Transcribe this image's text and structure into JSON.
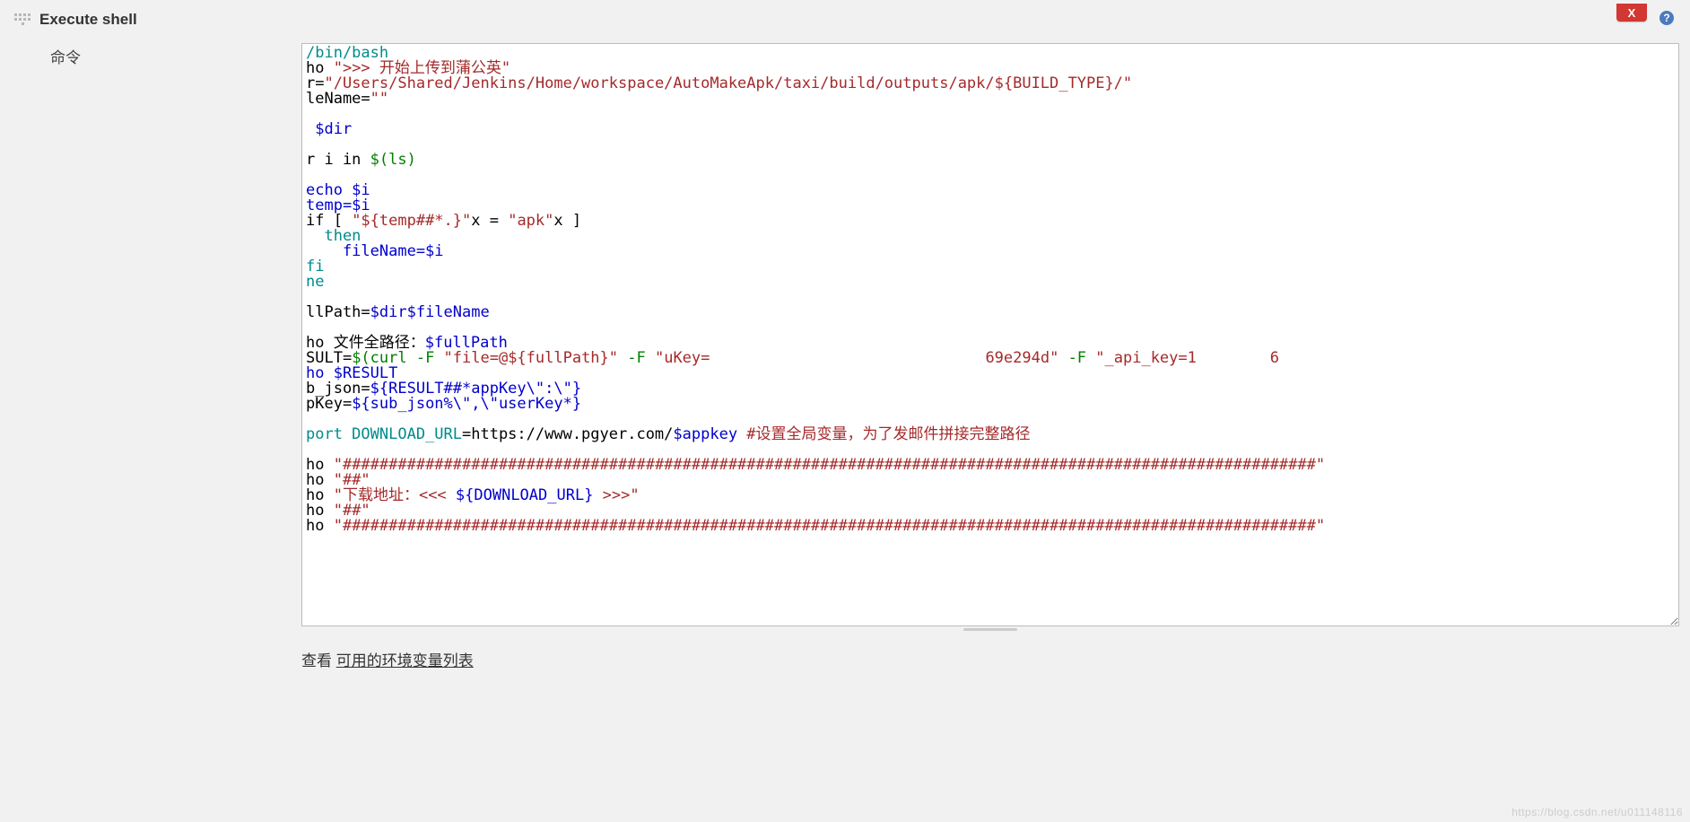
{
  "step": {
    "title": "Execute shell",
    "delete_label": "X",
    "help_label": "?",
    "command_label": "命令"
  },
  "code": {
    "shebang": "/bin/bash",
    "echo1_pre": "ho ",
    "echo1_str": "\">>> 开始上传到蒲公英\"",
    "dir_pre": "r=",
    "dir_str": "\"/Users/Shared/Jenkins/Home/workspace/AutoMakeApk/taxi/build/outputs/apk/${BUILD_TYPE}/\"",
    "filename_pre": "leName=",
    "filename_str": "\"\"",
    "cd_dir": " $dir",
    "for_pre": "r i in ",
    "for_sub": "$(ls)",
    "loop_echo": "echo $i",
    "loop_temp": "temp=$i",
    "if_pre": "if [ ",
    "if_str": "\"${temp##*.}\"",
    "if_mid": "x = ",
    "if_apk": "\"apk\"",
    "if_end": "x ]",
    "then": "  then",
    "assign_fn": "    fileName=$i",
    "fi": "fi",
    "done": "ne",
    "llpath_pre": "llPath=",
    "llpath_val": "$dir$fileName",
    "echo_full_pre": "ho 文件全路径：",
    "echo_full_val": "$fullPath",
    "result_pre": "SULT=",
    "result_sub1": "$(curl -F ",
    "result_file": "\"file=@${fullPath}\"",
    "result_flag1": " -F ",
    "result_ukey": "\"uKey=",
    "result_ukey_end": "69e294d\"",
    "result_flag2": " -F ",
    "result_api": "\"_api_key=1",
    "result_tail": "6",
    "echo_result": "ho $RESULT",
    "bjson_pre": "b_json=",
    "bjson_val": "${RESULT##*appKey\\\":\\\"}",
    "pkey_pre": "pKey=",
    "pkey_val": "${sub_json%\\\",\\\"userKey*}",
    "export_pre": "port DOWNLOAD_URL",
    "export_eq": "=https://www.pgyer.com/",
    "export_var": "$appkey",
    "export_cmt": " #设置全局变量，为了发邮件拼接完整路径",
    "hash_long": "\"##########################################################################################################\"",
    "hash_short": "\"##\"",
    "dl_pre": "ho ",
    "dl_str1": "\"下载地址：<<< ",
    "dl_var": "${DOWNLOAD_URL}",
    "dl_str2": " >>>\"",
    "ho_pre": "ho "
  },
  "footer": {
    "prefix": "查看 ",
    "link": "可用的环境变量列表"
  },
  "watermark": "https://blog.csdn.net/u011148116"
}
